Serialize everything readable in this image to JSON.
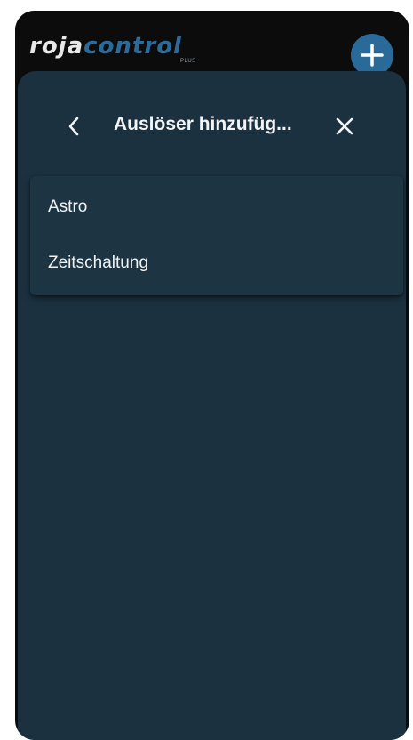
{
  "app": {
    "logo_part1": "roja",
    "logo_part2": "control",
    "logo_badge": "PLUS"
  },
  "header": {
    "title": "Auslöser hinzufüg..."
  },
  "menu": {
    "items": [
      {
        "label": "Astro"
      },
      {
        "label": "Zeitschaltung"
      }
    ]
  },
  "icons": {
    "back": "chevron-left-icon",
    "close": "close-icon",
    "fab": "plus-icon"
  },
  "colors": {
    "sheet_background": "#1b3140",
    "accent": "#2a6a98",
    "text": "#f0f2f4"
  }
}
